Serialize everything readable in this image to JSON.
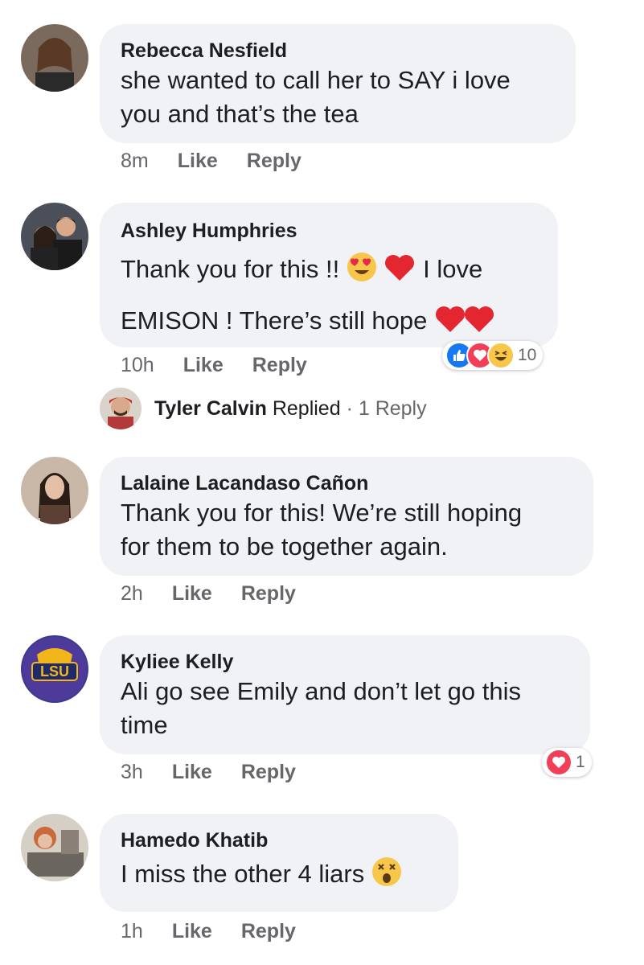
{
  "comments": [
    {
      "author": "Rebecca Nesfield",
      "text_line1": "she wanted to call her to SAY i love",
      "text_line2": "you and that’s the tea",
      "time": "8m",
      "like": "Like",
      "reply": "Reply"
    },
    {
      "author": "Ashley Humphries",
      "text_line1": "Thank you for this !!",
      "text_line1b": "I love",
      "text_line2": "EMISON ! There’s still hope",
      "time": "10h",
      "like": "Like",
      "reply": "Reply",
      "reaction_count": "10"
    },
    {
      "author": "Lalaine Lacandaso Cañon",
      "text_line1": "Thank you for this! We’re still hoping",
      "text_line2": "for them to be together again.",
      "time": "2h",
      "like": "Like",
      "reply": "Reply"
    },
    {
      "author": "Kyliee Kelly",
      "text_line1": "Ali go see Emily and don’t let go this",
      "text_line2": "time",
      "time": "3h",
      "like": "Like",
      "reply": "Reply",
      "reaction_count": "1"
    },
    {
      "author": "Hamedo Khatib",
      "text_line1": "I miss the other 4 liars",
      "time": "1h",
      "like": "Like",
      "reply": "Reply"
    }
  ],
  "reply_summary": {
    "name": "Tyler Calvin",
    "verb": "Replied",
    "sep": "·",
    "count": "1 Reply"
  },
  "avatar_badge": "LSU",
  "colors": {
    "bubble": "#f0f2f5",
    "meta": "#65676b",
    "like_blue": "#1877f2",
    "love_red": "#f33e58"
  }
}
